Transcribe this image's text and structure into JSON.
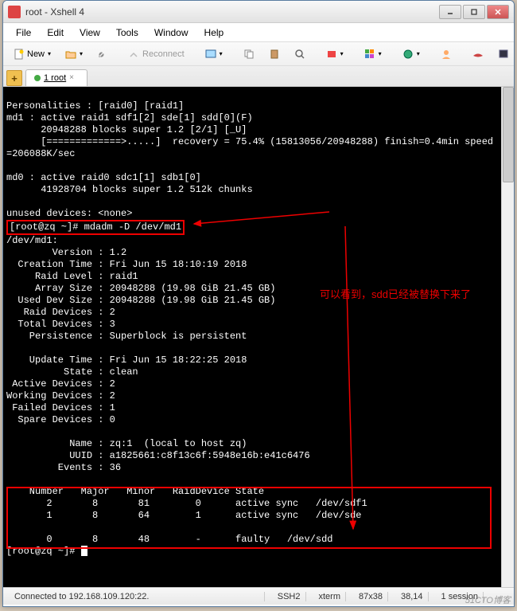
{
  "window": {
    "title": "root - Xshell 4"
  },
  "menu": {
    "file": "File",
    "edit": "Edit",
    "view": "View",
    "tools": "Tools",
    "window": "Window",
    "help": "Help"
  },
  "toolbar": {
    "new_label": "New",
    "reconnect_label": "Reconnect"
  },
  "tabs": {
    "main": "1 root"
  },
  "terminal": {
    "line1": "Personalities : [raid0] [raid1]",
    "line2": "md1 : active raid1 sdf1[2] sde[1] sdd[0](F)",
    "line3": "      20948288 blocks super 1.2 [2/1] [_U]",
    "line4": "      [=============>.....]  recovery = 75.4% (15813056/20948288) finish=0.4min speed",
    "line5": "=206088K/sec",
    "line6": "",
    "line7": "md0 : active raid0 sdc1[1] sdb1[0]",
    "line8": "      41928704 blocks super 1.2 512k chunks",
    "line9": "",
    "line10": "unused devices: <none>",
    "prompt1_user": "[root@zq ~]# ",
    "prompt1_cmd": "mdadm -D /dev/md1",
    "md_header": "/dev/md1:",
    "md_version": "        Version : 1.2",
    "md_creation": "  Creation Time : Fri Jun 15 18:10:19 2018",
    "md_raidlevel": "     Raid Level : raid1",
    "md_arraysize": "     Array Size : 20948288 (19.98 GiB 21.45 GB)",
    "md_useddev": "  Used Dev Size : 20948288 (19.98 GiB 21.45 GB)",
    "md_raiddev": "   Raid Devices : 2",
    "md_totaldev": "  Total Devices : 3",
    "md_persist": "    Persistence : Superblock is persistent",
    "md_blank1": "",
    "md_update": "    Update Time : Fri Jun 15 18:22:25 2018",
    "md_state": "          State : clean",
    "md_active": " Active Devices : 2",
    "md_working": "Working Devices : 2",
    "md_failed": " Failed Devices : 1",
    "md_spare": "  Spare Devices : 0",
    "md_blank2": "",
    "md_name": "           Name : zq:1  (local to host zq)",
    "md_uuid": "           UUID : a1825661:c8f13c6f:5948e16b:e41c6476",
    "md_events": "         Events : 36",
    "md_blank3": "",
    "tbl_header": "    Number   Major   Minor   RaidDevice State",
    "tbl_row1": "       2       8       81        0      active sync   /dev/sdf1",
    "tbl_row2": "       1       8       64        1      active sync   /dev/sde",
    "tbl_blank": "",
    "tbl_row3": "       0       8       48        -      faulty   /dev/sdd",
    "prompt2": "[root@zq ~]# "
  },
  "annotation": {
    "text": "可以看到，sdd已经被替换下来了"
  },
  "status": {
    "connected": "Connected to 192.168.109.120:22.",
    "ssh": "SSH2",
    "term": "xterm",
    "size": "87x38",
    "pos": "38,14",
    "session": "1 session"
  },
  "watermark": "51CTO博客"
}
